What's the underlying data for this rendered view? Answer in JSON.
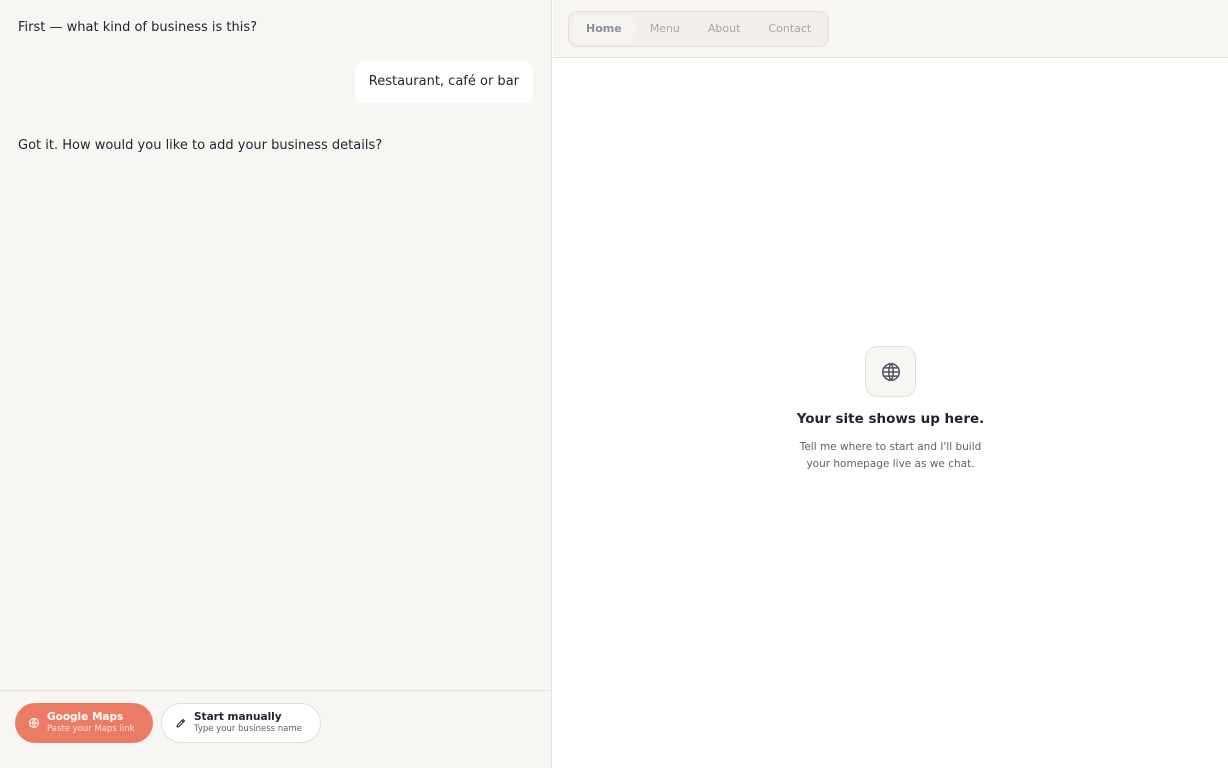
{
  "chat": {
    "messages": [
      {
        "role": "assistant",
        "text": "First — what kind of business is this?"
      },
      {
        "role": "user",
        "text": "Restaurant, café or bar"
      },
      {
        "role": "assistant",
        "text": "Got it. How would you like to add your business details?"
      }
    ],
    "options": [
      {
        "title": "Google Maps",
        "subtitle": "Paste your Maps link",
        "icon": "globe-icon"
      },
      {
        "title": "Start manually",
        "subtitle": "Type your business name",
        "icon": "pencil-icon"
      }
    ]
  },
  "preview": {
    "tabs": [
      {
        "label": "Home",
        "active": true
      },
      {
        "label": "Menu",
        "active": false
      },
      {
        "label": "About",
        "active": false
      },
      {
        "label": "Contact",
        "active": false
      }
    ],
    "empty": {
      "icon": "globe-icon",
      "title": "Your site shows up here.",
      "subtitle": "Tell me where to start and I'll build your homepage live as we chat."
    }
  },
  "colors": {
    "accent": "#ec7b66",
    "panel_bg": "#f8f6f3",
    "text": "#1f2430",
    "muted": "#5c6270"
  }
}
